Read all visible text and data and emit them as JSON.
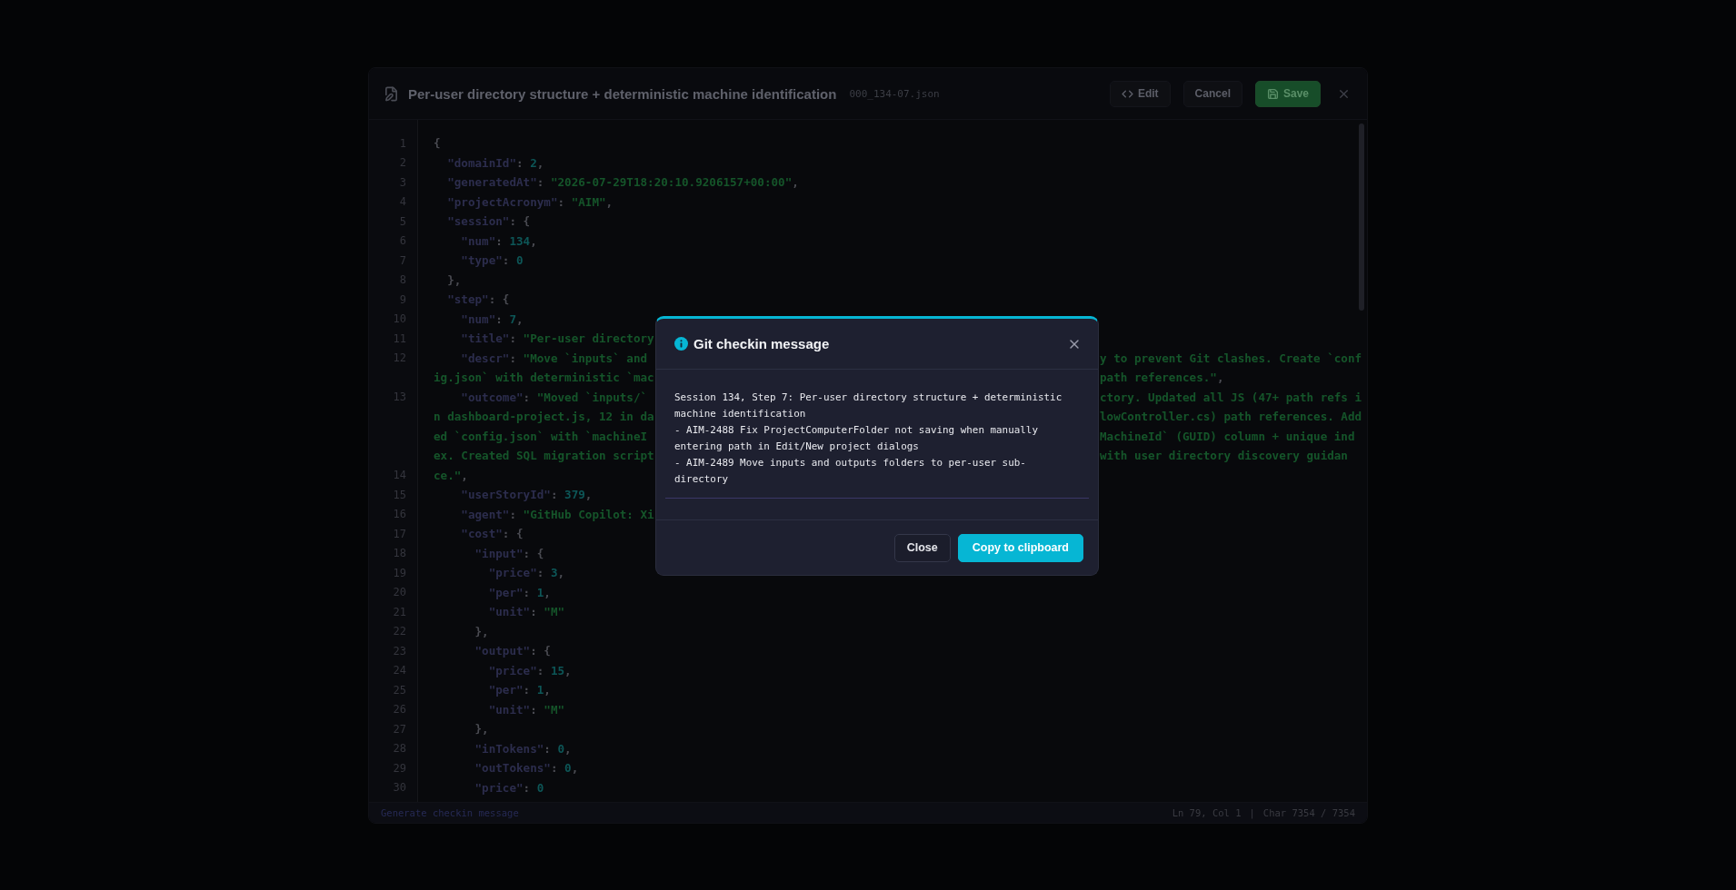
{
  "editor": {
    "title": "Per-user directory structure + deterministic machine identification",
    "filename": "000_134-07.json",
    "buttons": [
      {
        "kind": "edit",
        "label": "Edit"
      },
      {
        "kind": "cancel",
        "label": "Cancel"
      },
      {
        "kind": "save",
        "label": "Save"
      }
    ],
    "rows": [
      {
        "number": "1",
        "left": [
          {
            "kind": "punct",
            "text": "{"
          }
        ]
      },
      {
        "number": "2",
        "left": [
          {
            "kind": "key",
            "text": "  \"domainId\""
          },
          {
            "kind": "punct",
            "text": ": "
          },
          {
            "kind": "number",
            "text": "2"
          },
          {
            "kind": "punct",
            "text": ","
          }
        ]
      },
      {
        "number": "3",
        "left": [
          {
            "kind": "key",
            "text": "  \"generatedAt\""
          },
          {
            "kind": "punct",
            "text": ": "
          },
          {
            "kind": "string",
            "text": "\"2026-07-29T18:20:10.9206157+00:00\""
          },
          {
            "kind": "punct",
            "text": ","
          }
        ]
      },
      {
        "number": "4",
        "left": [
          {
            "kind": "key",
            "text": "  \"projectAcronym\""
          },
          {
            "kind": "punct",
            "text": ": "
          },
          {
            "kind": "string",
            "text": "\"AIM\""
          },
          {
            "kind": "punct",
            "text": ","
          }
        ]
      },
      {
        "number": "5",
        "left": [
          {
            "kind": "key",
            "text": "  \"session\""
          },
          {
            "kind": "punct",
            "text": ": {"
          }
        ]
      },
      {
        "number": "6",
        "left": [
          {
            "kind": "key",
            "text": "    \"num\""
          },
          {
            "kind": "punct",
            "text": ": "
          },
          {
            "kind": "number",
            "text": "134"
          },
          {
            "kind": "punct",
            "text": ","
          }
        ]
      },
      {
        "number": "7",
        "left": [
          {
            "kind": "key",
            "text": "    \"type\""
          },
          {
            "kind": "punct",
            "text": ": "
          },
          {
            "kind": "number",
            "text": "0"
          }
        ]
      },
      {
        "number": "8",
        "left": [
          {
            "kind": "punct",
            "text": "  },"
          }
        ]
      },
      {
        "number": "9",
        "left": [
          {
            "kind": "key",
            "text": "  \"step\""
          },
          {
            "kind": "punct",
            "text": ": {"
          }
        ]
      },
      {
        "number": "10",
        "left": [
          {
            "kind": "key",
            "text": "    \"num\""
          },
          {
            "kind": "punct",
            "text": ": "
          },
          {
            "kind": "number",
            "text": "7"
          },
          {
            "kind": "punct",
            "text": ","
          }
        ]
      },
      {
        "number": "11",
        "left": [
          {
            "kind": "key",
            "text": "    \"title\""
          },
          {
            "kind": "punct",
            "text": ": "
          },
          {
            "kind": "string",
            "text": "\"Per-user directory"
          }
        ]
      },
      {
        "number": "12",
        "left": [
          {
            "kind": "key",
            "text": "    \"descr\""
          },
          {
            "kind": "punct",
            "text": ": "
          },
          {
            "kind": "string",
            "text": "\"Move `inputs` and"
          }
        ],
        "right": [
          {
            "kind": "string",
            "text": "y to prevent Git clashes. Create `conf"
          }
        ]
      },
      {
        "left": [
          {
            "kind": "string",
            "text": "ig.json` with deterministic `mac"
          }
        ],
        "right": [
          {
            "kind": "string",
            "text": "path references.\""
          },
          {
            "kind": "punct",
            "text": ","
          }
        ]
      },
      {
        "number": "13",
        "left": [
          {
            "kind": "key",
            "text": "    \"outcome\""
          },
          {
            "kind": "punct",
            "text": ": "
          },
          {
            "kind": "string",
            "text": "\"Moved `inputs/`"
          }
        ],
        "right": [
          {
            "kind": "string",
            "text": "ctory. Updated all JS (47+ path refs i"
          }
        ]
      },
      {
        "left": [
          {
            "kind": "string",
            "text": "n dashboard-project.js, 12 in da"
          }
        ],
        "right": [
          {
            "kind": "string",
            "text": "lowController.cs) path references. Add"
          }
        ]
      },
      {
        "left": [
          {
            "kind": "string",
            "text": "ed `config.json` with `machineI"
          }
        ],
        "right": [
          {
            "kind": "string",
            "text": "MachineId` (GUID) column + unique ind"
          }
        ]
      },
      {
        "left": [
          {
            "kind": "string",
            "text": "ex. Created SQL migration script"
          }
        ],
        "right": [
          {
            "kind": "string",
            "text": "with user directory discovery guidan"
          }
        ]
      },
      {
        "number": "14",
        "left": [
          {
            "kind": "string",
            "text": "ce.\""
          },
          {
            "kind": "punct",
            "text": ","
          }
        ]
      },
      {
        "number": "15",
        "left": [
          {
            "kind": "key",
            "text": "    \"userStoryId\""
          },
          {
            "kind": "punct",
            "text": ": "
          },
          {
            "kind": "number",
            "text": "379"
          },
          {
            "kind": "punct",
            "text": ","
          }
        ]
      },
      {
        "number": "16",
        "left": [
          {
            "kind": "key",
            "text": "    \"agent\""
          },
          {
            "kind": "punct",
            "text": ": "
          },
          {
            "kind": "string",
            "text": "\"GitHub Copilot: Xi"
          }
        ]
      },
      {
        "number": "17",
        "left": [
          {
            "kind": "key",
            "text": "    \"cost\""
          },
          {
            "kind": "punct",
            "text": ": {"
          }
        ]
      },
      {
        "number": "18",
        "left": [
          {
            "kind": "key",
            "text": "      \"input\""
          },
          {
            "kind": "punct",
            "text": ": {"
          }
        ]
      },
      {
        "number": "19",
        "left": [
          {
            "kind": "key",
            "text": "        \"price\""
          },
          {
            "kind": "punct",
            "text": ": "
          },
          {
            "kind": "number",
            "text": "3"
          },
          {
            "kind": "punct",
            "text": ","
          }
        ]
      },
      {
        "number": "20",
        "left": [
          {
            "kind": "key",
            "text": "        \"per\""
          },
          {
            "kind": "punct",
            "text": ": "
          },
          {
            "kind": "number",
            "text": "1"
          },
          {
            "kind": "punct",
            "text": ","
          }
        ]
      },
      {
        "number": "21",
        "left": [
          {
            "kind": "key",
            "text": "        \"unit\""
          },
          {
            "kind": "punct",
            "text": ": "
          },
          {
            "kind": "string",
            "text": "\"M\""
          }
        ]
      },
      {
        "number": "22",
        "left": [
          {
            "kind": "punct",
            "text": "      },"
          }
        ]
      },
      {
        "number": "23",
        "left": [
          {
            "kind": "key",
            "text": "      \"output\""
          },
          {
            "kind": "punct",
            "text": ": {"
          }
        ]
      },
      {
        "number": "24",
        "left": [
          {
            "kind": "key",
            "text": "        \"price\""
          },
          {
            "kind": "punct",
            "text": ": "
          },
          {
            "kind": "number",
            "text": "15"
          },
          {
            "kind": "punct",
            "text": ","
          }
        ]
      },
      {
        "number": "25",
        "left": [
          {
            "kind": "key",
            "text": "        \"per\""
          },
          {
            "kind": "punct",
            "text": ": "
          },
          {
            "kind": "number",
            "text": "1"
          },
          {
            "kind": "punct",
            "text": ","
          }
        ]
      },
      {
        "number": "26",
        "left": [
          {
            "kind": "key",
            "text": "        \"unit\""
          },
          {
            "kind": "punct",
            "text": ": "
          },
          {
            "kind": "string",
            "text": "\"M\""
          }
        ]
      },
      {
        "number": "27",
        "left": [
          {
            "kind": "punct",
            "text": "      },"
          }
        ]
      },
      {
        "number": "28",
        "left": [
          {
            "kind": "key",
            "text": "      \"inTokens\""
          },
          {
            "kind": "punct",
            "text": ": "
          },
          {
            "kind": "number",
            "text": "0"
          },
          {
            "kind": "punct",
            "text": ","
          }
        ]
      },
      {
        "number": "29",
        "left": [
          {
            "kind": "key",
            "text": "      \"outTokens\""
          },
          {
            "kind": "punct",
            "text": ": "
          },
          {
            "kind": "number",
            "text": "0"
          },
          {
            "kind": "punct",
            "text": ","
          }
        ]
      },
      {
        "number": "30",
        "left": [
          {
            "kind": "key",
            "text": "      \"price\""
          },
          {
            "kind": "punct",
            "text": ": "
          },
          {
            "kind": "number",
            "text": "0"
          }
        ]
      }
    ],
    "status_bar": {
      "action": "Generate checkin message",
      "position": "Ln 79, Col 1",
      "separator": "|",
      "chars": "Char 7354 / 7354"
    }
  },
  "dialog": {
    "title": "Git checkin message",
    "message": "Session 134, Step 7: Per-user directory structure + deterministic machine identification\n- AIM-2488 Fix ProjectComputerFolder not saving when manually entering path in Edit/New project dialogs\n- AIM-2489 Move inputs and outputs folders to per-user sub-directory",
    "buttons": [
      {
        "kind": "secondary",
        "label": "Close"
      },
      {
        "kind": "primary",
        "label": "Copy to clipboard"
      }
    ]
  }
}
